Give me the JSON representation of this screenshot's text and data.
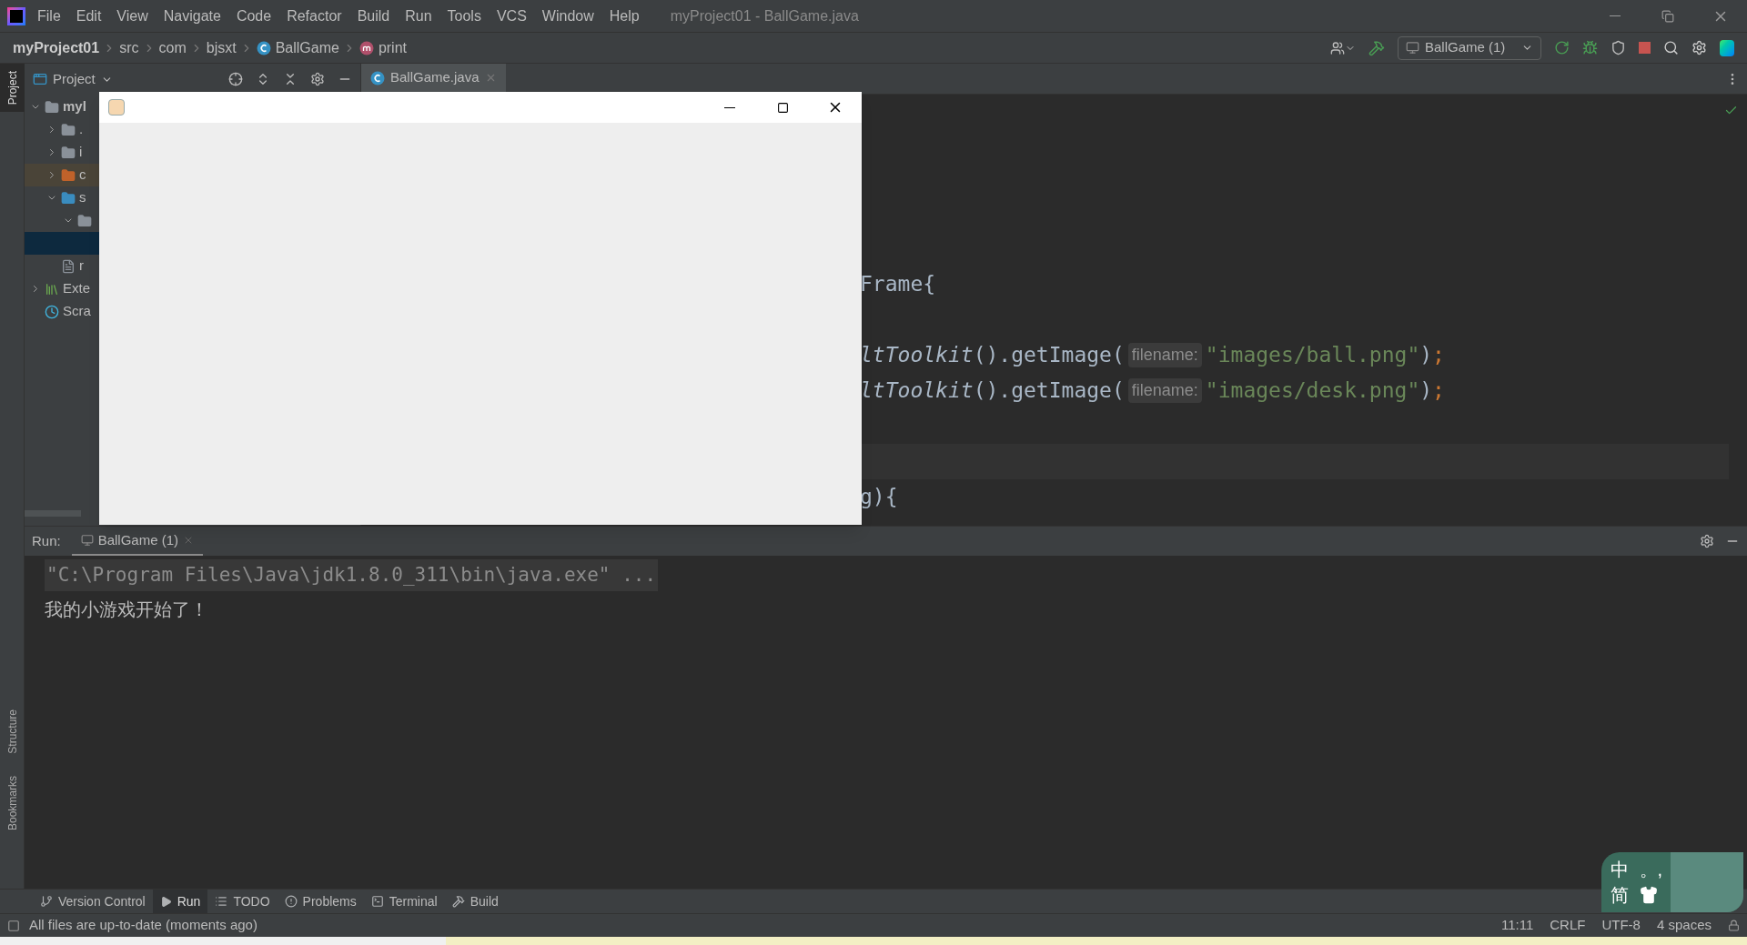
{
  "menu_bar": {
    "items": [
      "File",
      "Edit",
      "View",
      "Navigate",
      "Code",
      "Refactor",
      "Build",
      "Run",
      "Tools",
      "VCS",
      "Window",
      "Help"
    ],
    "title": "myProject01 - BallGame.java"
  },
  "breadcrumb": [
    {
      "label": "myProject01",
      "kind": "project"
    },
    {
      "label": "src",
      "kind": "dir"
    },
    {
      "label": "com",
      "kind": "dir"
    },
    {
      "label": "bjsxt",
      "kind": "dir"
    },
    {
      "label": "BallGame",
      "kind": "class"
    },
    {
      "label": "print",
      "kind": "method"
    }
  ],
  "run_config": "BallGame (1)",
  "side_strip": [
    {
      "label": "Project",
      "selected": true
    },
    {
      "label": "Structure",
      "selected": false
    },
    {
      "label": "Bookmarks",
      "selected": false
    }
  ],
  "project_panel": {
    "title": "Project",
    "tree": [
      {
        "label": "myl",
        "kind": "module",
        "expanded": true,
        "selected": false,
        "children": [
          {
            "label": ".",
            "kind": "folder",
            "expanded": false,
            "selected": false
          },
          {
            "label": "i",
            "kind": "folder",
            "expanded": false,
            "selected": false
          },
          {
            "label": "c",
            "kind": "excluded",
            "expanded": false,
            "selected": false
          },
          {
            "label": "s",
            "kind": "source",
            "expanded": true,
            "selected": false,
            "children": [
              {
                "kind": "package",
                "expanded": true,
                "selected": false,
                "children": [
                  {
                    "selected": true
                  }
                ]
              }
            ]
          },
          {
            "label": "r",
            "kind": "file",
            "selected": false
          }
        ]
      },
      {
        "label": "Exte",
        "kind": "libraries",
        "expanded": false,
        "selected": false
      },
      {
        "label": "Scra",
        "kind": "scratches",
        "selected": false
      }
    ]
  },
  "editor_tabs": [
    {
      "label": "BallGame.java",
      "selected": true
    }
  ],
  "code_lines": [
    {
      "kind": "text",
      "segments": [
        {
          "kind": "plain",
          "text": "Frame{"
        }
      ]
    },
    {
      "kind": "text",
      "segments": [
        {
          "kind": "italic",
          "text": "ltToolkit"
        },
        {
          "kind": "plain",
          "text": "().getImage("
        },
        {
          "kind": "hint",
          "text": "filename:"
        },
        {
          "kind": "string",
          "text": "\"images/ball.png\""
        },
        {
          "kind": "plain",
          "text": ")"
        },
        {
          "kind": "punct",
          "text": ";"
        }
      ]
    },
    {
      "kind": "text",
      "segments": [
        {
          "kind": "italic",
          "text": "ltToolkit"
        },
        {
          "kind": "plain",
          "text": "().getImage("
        },
        {
          "kind": "hint",
          "text": "filename:"
        },
        {
          "kind": "string",
          "text": "\"images/desk.png\""
        },
        {
          "kind": "plain",
          "text": ")"
        },
        {
          "kind": "punct",
          "text": ";"
        }
      ]
    },
    {
      "kind": "caret_line"
    },
    {
      "kind": "text",
      "segments": [
        {
          "kind": "plain",
          "text": "g){"
        }
      ]
    }
  ],
  "run_panel": {
    "label": "Run:",
    "tabs": [
      {
        "label": "BallGame (1)",
        "selected": true
      }
    ],
    "console": [
      {
        "kind": "command",
        "text": "\"C:\\Program Files\\Java\\jdk1.8.0_311\\bin\\java.exe\" ..."
      },
      {
        "kind": "output",
        "text": "我的小游戏开始了！"
      }
    ]
  },
  "bottom_tabs": [
    {
      "label": "Version Control",
      "selected": false
    },
    {
      "label": "Run",
      "selected": true
    },
    {
      "label": "TODO",
      "selected": false
    },
    {
      "label": "Problems",
      "selected": false
    },
    {
      "label": "Terminal",
      "selected": false
    },
    {
      "label": "Build",
      "selected": false
    }
  ],
  "status_bar": {
    "message": "All files are up-to-date (moments ago)",
    "items": [
      "11:11",
      "CRLF",
      "UTF-8",
      "4 spaces"
    ]
  },
  "ime": {
    "mode": "中",
    "punctuation": "。,",
    "script": "简"
  }
}
